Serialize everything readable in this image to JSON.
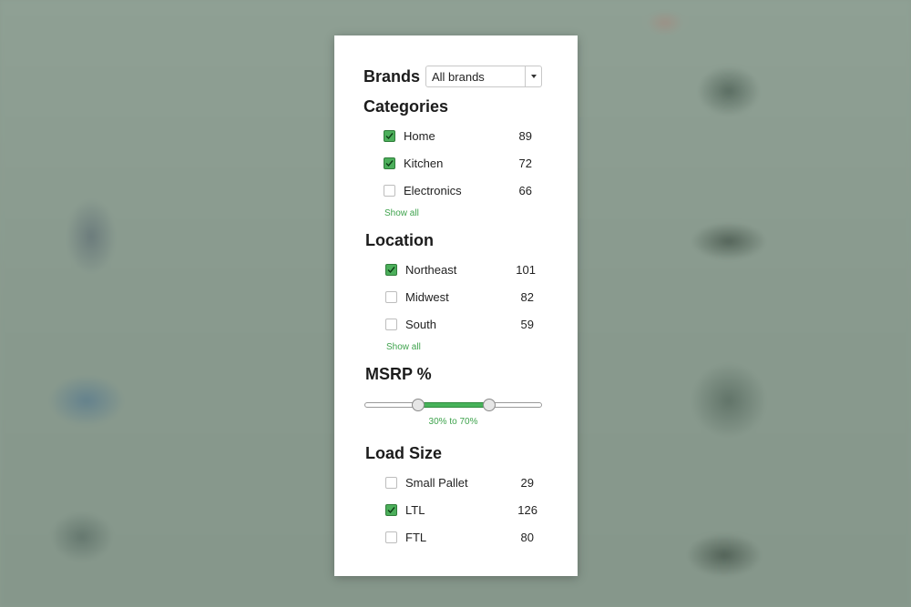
{
  "colors": {
    "accent": "#4caf5b",
    "link": "#3fa34d",
    "background": "#8b9c90"
  },
  "brands": {
    "title": "Brands",
    "selected": "All brands",
    "arrow_icon": "chevron-down-icon"
  },
  "categories": {
    "title": "Categories",
    "items": [
      {
        "label": "Home",
        "count": "89",
        "checked": true
      },
      {
        "label": "Kitchen",
        "count": "72",
        "checked": true
      },
      {
        "label": "Electronics",
        "count": "66",
        "checked": false
      }
    ],
    "show_all": "Show all"
  },
  "location": {
    "title": "Location",
    "items": [
      {
        "label": "Northeast",
        "count": "101",
        "checked": true
      },
      {
        "label": "Midwest",
        "count": "82",
        "checked": false
      },
      {
        "label": "South",
        "count": "59",
        "checked": false
      }
    ],
    "show_all": "Show all"
  },
  "msrp": {
    "title": "MSRP %",
    "min": 30,
    "max": 70,
    "range_text": "30% to 70%"
  },
  "load_size": {
    "title": "Load Size",
    "items": [
      {
        "label": "Small Pallet",
        "count": "29",
        "checked": false
      },
      {
        "label": "LTL",
        "count": "126",
        "checked": true
      },
      {
        "label": "FTL",
        "count": "80",
        "checked": false
      }
    ]
  }
}
